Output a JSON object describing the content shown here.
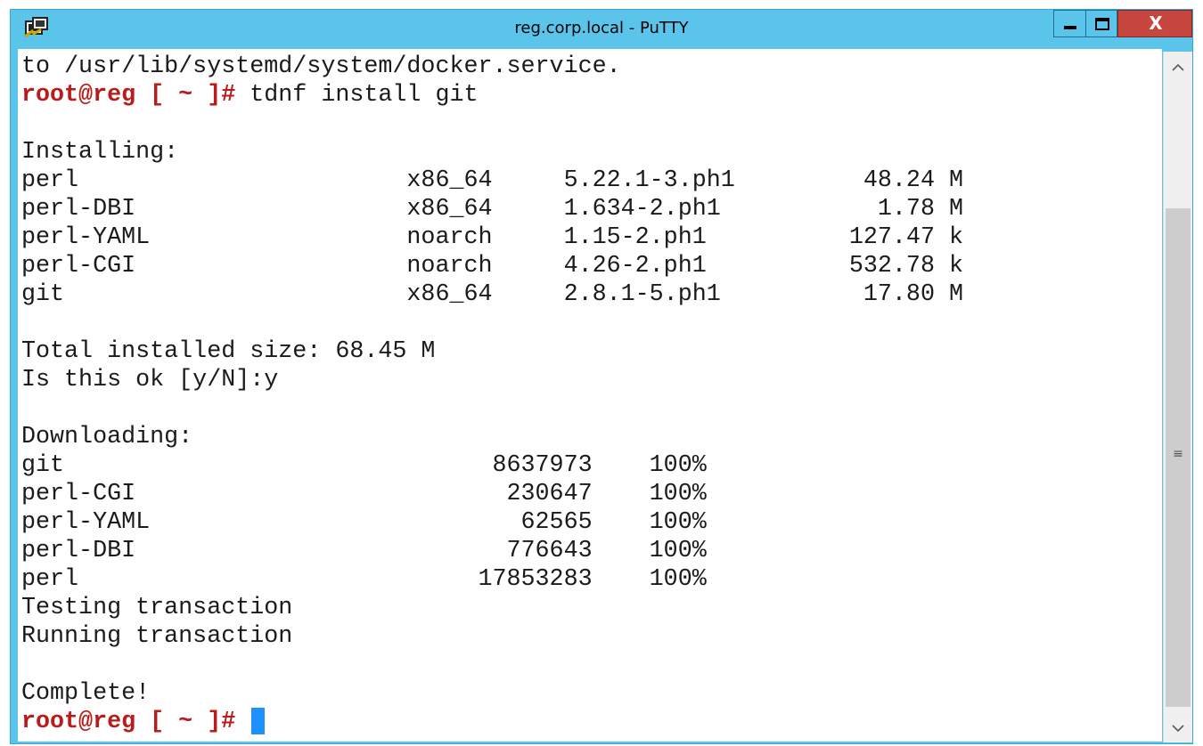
{
  "window": {
    "title": "reg.corp.local - PuTTY",
    "accent": "#5ac4ea",
    "close_color": "#c7463d",
    "icons": [
      "putty-app-icon",
      "minimize-icon",
      "maximize-icon",
      "close-icon"
    ]
  },
  "terminal": {
    "prompt_color": "#bb1a1a",
    "cursor_color": "#1e90ff",
    "lines": [
      "to /usr/lib/systemd/system/docker.service.",
      "",
      "",
      "Installing:",
      "perl                       x86_64     5.22.1-3.ph1         48.24 M",
      "perl-DBI                   x86_64     1.634-2.ph1           1.78 M",
      "perl-YAML                  noarch     1.15-2.ph1          127.47 k",
      "perl-CGI                   noarch     4.26-2.ph1          532.78 k",
      "git                        x86_64     2.8.1-5.ph1          17.80 M",
      "",
      "Total installed size: 68.45 M",
      "Is this ok [y/N]:y",
      "",
      "Downloading:",
      "git                              8637973    100%",
      "perl-CGI                          230647    100%",
      "perl-YAML                          62565    100%",
      "perl-DBI                          776643    100%",
      "perl                            17853283    100%",
      "Testing transaction",
      "Running transaction",
      "",
      "Complete!",
      ""
    ],
    "prompt": "root@reg [ ~ ]#",
    "command": " tdnf install git",
    "final_prompt": "root@reg [ ~ ]#"
  },
  "scrollbar": {
    "up_arrow": "^",
    "down_arrow": "v",
    "grip": "≡"
  }
}
